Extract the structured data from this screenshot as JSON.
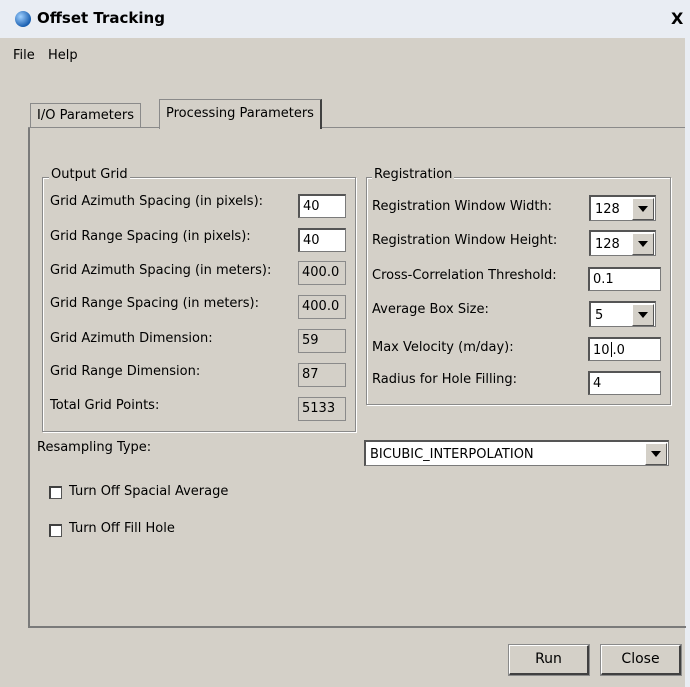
{
  "window": {
    "title": "Offset Tracking",
    "close_glyph": "X",
    "icon": "app-globe-icon"
  },
  "menu": [
    "File",
    "Help"
  ],
  "tabs": [
    {
      "label": "I/O Parameters",
      "active": false
    },
    {
      "label": "Processing Parameters",
      "active": true
    }
  ],
  "output_grid": {
    "title": "Output Grid",
    "rows": [
      {
        "label": "Grid Azimuth Spacing (in pixels):",
        "value": "40",
        "editable": true
      },
      {
        "label": "Grid Range Spacing (in pixels):",
        "value": "40",
        "editable": true
      },
      {
        "label": "Grid Azimuth Spacing (in meters):",
        "value": "400.0",
        "editable": false
      },
      {
        "label": "Grid Range Spacing (in meters):",
        "value": "400.0",
        "editable": false
      },
      {
        "label": "Grid Azimuth Dimension:",
        "value": "59",
        "editable": false
      },
      {
        "label": "Grid Range Dimension:",
        "value": "87",
        "editable": false
      },
      {
        "label": "Total Grid Points:",
        "value": "5133",
        "editable": false
      }
    ]
  },
  "registration": {
    "title": "Registration",
    "rows": [
      {
        "label": "Registration Window Width:",
        "value": "128",
        "type": "combo"
      },
      {
        "label": "Registration Window Height:",
        "value": "128",
        "type": "combo"
      },
      {
        "label": "Cross-Correlation Threshold:",
        "value": "0.1",
        "type": "text"
      },
      {
        "label": "Average Box Size:",
        "value": "5",
        "type": "combo"
      },
      {
        "label": "Max Velocity (m/day):",
        "value_before_caret": "10",
        "value_after_caret": ".0",
        "type": "text"
      },
      {
        "label": "Radius for Hole Filling:",
        "value": "4",
        "type": "text"
      }
    ]
  },
  "resampling": {
    "label": "Resampling Type:",
    "value": "BICUBIC_INTERPOLATION"
  },
  "checkboxes": [
    {
      "label": "Turn Off Spacial Average",
      "checked": false
    },
    {
      "label": "Turn Off Fill Hole",
      "checked": false
    }
  ],
  "buttons": {
    "run": "Run",
    "close": "Close"
  }
}
